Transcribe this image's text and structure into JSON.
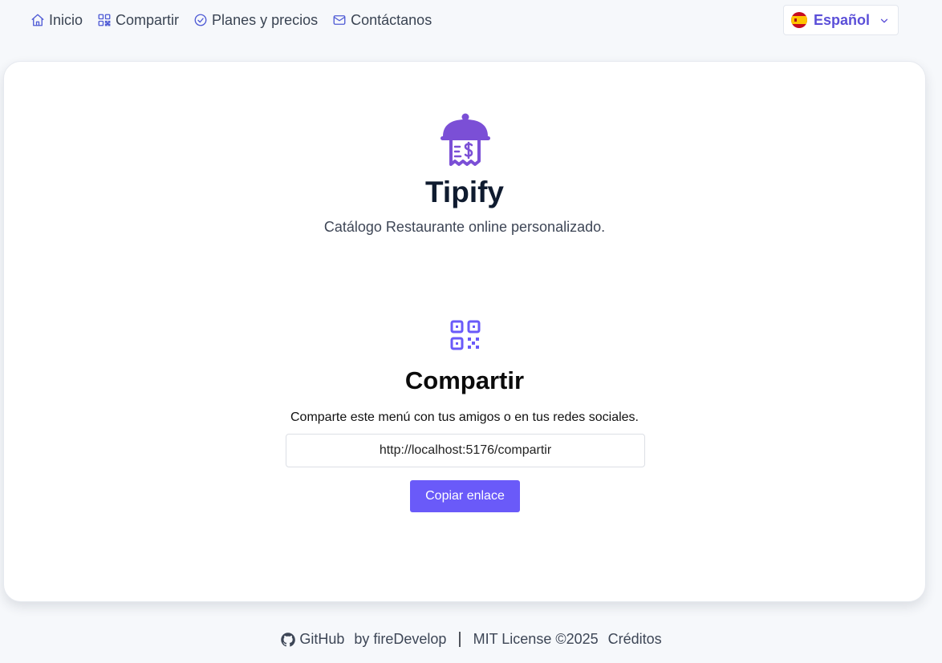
{
  "nav": {
    "items": [
      {
        "label": "Inicio",
        "icon": "home-icon"
      },
      {
        "label": "Compartir",
        "icon": "qr-code-icon"
      },
      {
        "label": "Planes y precios",
        "icon": "check-circle-icon"
      },
      {
        "label": "Contáctanos",
        "icon": "mail-icon"
      }
    ]
  },
  "language": {
    "label": "Español",
    "icon": "spain-flag-icon"
  },
  "hero": {
    "brand": "Tipify",
    "tagline": "Catálogo Restaurante online personalizado."
  },
  "share": {
    "title": "Compartir",
    "description": "Comparte este menú con tus amigos o en tus redes sociales.",
    "url": "http://localhost:5176/compartir",
    "button_label": "Copiar enlace"
  },
  "footer": {
    "github": "GitHub",
    "by": "by fireDevelop",
    "separator": "|",
    "license": "MIT License ©2025",
    "credits": "Créditos"
  },
  "colors": {
    "accent": "#6a5af9",
    "language_text": "#5b4fd8",
    "background": "#f6f8fb"
  }
}
